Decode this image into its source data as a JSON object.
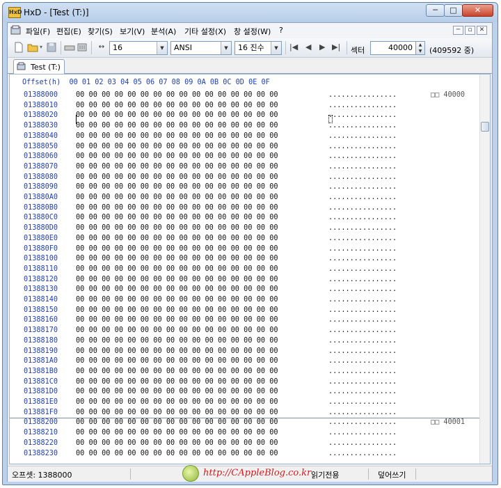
{
  "window": {
    "title": "HxD - [Test (T:)]",
    "min_glyph": "─",
    "max_glyph": "□",
    "close_glyph": "✕"
  },
  "menu": {
    "items": [
      "파일(F)",
      "편집(E)",
      "찾기(S)",
      "보기(V)",
      "분석(A)",
      "기타 설정(X)",
      "창 설정(W)",
      "?"
    ],
    "mdi_min": "─",
    "mdi_restore": "▫",
    "mdi_close": "✕"
  },
  "toolbar": {
    "bytes_per_row": "16",
    "charset": "ANSI",
    "offset_base": "16 진수",
    "sector_label": "섹터",
    "sector_value": "40000",
    "sector_total": "(409592 중)",
    "nav_first": "|◀",
    "nav_prev": "◀",
    "nav_next": "▶",
    "nav_last": "▶|"
  },
  "tabs": [
    {
      "label": "Test (T:)"
    }
  ],
  "editor": {
    "header": "Offset(h)  00 01 02 03 04 05 06 07 08 09 0A 0B 0C 0D 0E 0F",
    "hex_row": "00 00 00 00 00 00 00 00 00 00 00 00 00 00 00 00",
    "ascii_row": "................",
    "offsets": [
      "01388000",
      "01388010",
      "01388020",
      "01388030",
      "01388040",
      "01388050",
      "01388060",
      "01388070",
      "01388080",
      "01388090",
      "013880A0",
      "013880B0",
      "013880C0",
      "013880D0",
      "013880E0",
      "013880F0",
      "01388100",
      "01388110",
      "01388120",
      "01388130",
      "01388140",
      "01388150",
      "01388160",
      "01388170",
      "01388180",
      "01388190",
      "013881A0",
      "013881B0",
      "013881C0",
      "013881D0",
      "013881E0",
      "013881F0",
      "01388200",
      "01388210",
      "01388220",
      "01388230"
    ],
    "sector_markers": [
      {
        "row": 0,
        "text": "□□ 40000"
      },
      {
        "row": 32,
        "text": "□□ 40001"
      }
    ]
  },
  "status": {
    "offset": "오프셋: 1388000",
    "mode": "읽기전용",
    "insert": "덮어쓰기"
  },
  "watermark": {
    "text": "http://CAppleBlog.co.kr"
  }
}
